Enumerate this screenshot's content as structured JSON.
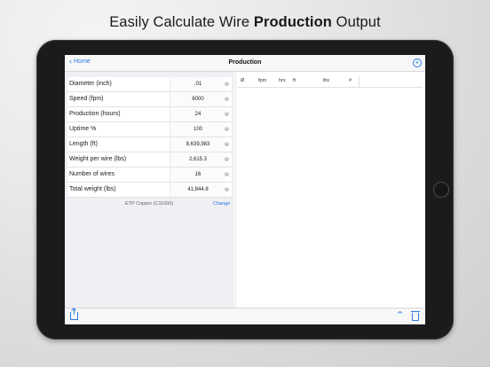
{
  "marketing": {
    "prefix": "Easily Calculate Wire ",
    "bold": "Production",
    "suffix": " Output"
  },
  "nav": {
    "back_label": "Home",
    "title": "Production"
  },
  "fields": [
    {
      "label": "Diameter (inch)",
      "value": ".01"
    },
    {
      "label": "Speed (fpm)",
      "value": "6000"
    },
    {
      "label": "Production (hours)",
      "value": "24"
    },
    {
      "label": "Uptime %",
      "value": "100"
    },
    {
      "label": "Length (ft)",
      "value": "8,639,983"
    },
    {
      "label": "Weight per wire (lbs)",
      "value": "2,615.3"
    },
    {
      "label": "Number of wires",
      "value": "16"
    },
    {
      "label": "Total weight (lbs)",
      "value": "41,844.8"
    }
  ],
  "material": {
    "name": "ETP Copper (C11000)",
    "change_label": "Change"
  },
  "table": {
    "headers": [
      "Ø",
      "fpm",
      "hrs",
      "ft",
      "lbs",
      "#"
    ]
  },
  "colors": {
    "accent": "#2a7ae2",
    "bezel": "#1b1b1d"
  },
  "icons": [
    "chevron-left-icon",
    "plus-circle-icon",
    "clear-icon",
    "share-icon",
    "chevron-up-icon",
    "trash-icon"
  ]
}
